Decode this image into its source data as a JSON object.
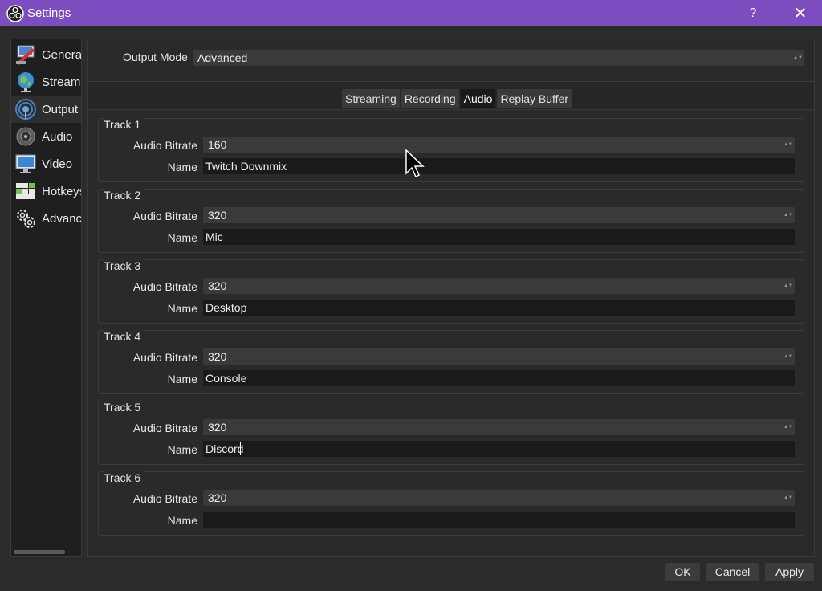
{
  "window": {
    "title": "Settings",
    "help_label": "?",
    "close_label": "✕"
  },
  "sidebar": {
    "items": [
      {
        "label": "General",
        "icon": "general-icon"
      },
      {
        "label": "Stream",
        "icon": "stream-globe-icon"
      },
      {
        "label": "Output",
        "icon": "output-broadcast-icon"
      },
      {
        "label": "Audio",
        "icon": "audio-speaker-icon"
      },
      {
        "label": "Video",
        "icon": "video-monitor-icon"
      },
      {
        "label": "Hotkeys",
        "icon": "hotkeys-keyboard-icon"
      },
      {
        "label": "Advanced",
        "icon": "advanced-gears-icon"
      }
    ],
    "active_index": 2
  },
  "output": {
    "mode_label": "Output Mode",
    "mode_value": "Advanced"
  },
  "tabs": [
    {
      "label": "Streaming"
    },
    {
      "label": "Recording"
    },
    {
      "label": "Audio",
      "active": true
    },
    {
      "label": "Replay Buffer"
    }
  ],
  "labels": {
    "audio_bitrate": "Audio Bitrate",
    "name": "Name"
  },
  "tracks": [
    {
      "title": "Track 1",
      "bitrate": "160",
      "name": "Twitch Downmix"
    },
    {
      "title": "Track 2",
      "bitrate": "320",
      "name": "Mic"
    },
    {
      "title": "Track 3",
      "bitrate": "320",
      "name": "Desktop"
    },
    {
      "title": "Track 4",
      "bitrate": "320",
      "name": "Console"
    },
    {
      "title": "Track 5",
      "bitrate": "320",
      "name": "Discord"
    },
    {
      "title": "Track 6",
      "bitrate": "320",
      "name": ""
    }
  ],
  "footer": {
    "ok": "OK",
    "cancel": "Cancel",
    "apply": "Apply"
  },
  "colors": {
    "titlebar": "#7b4dbf",
    "background": "#2b2b2b",
    "panel": "#2a2a2a",
    "input": "#1a1a1a"
  }
}
